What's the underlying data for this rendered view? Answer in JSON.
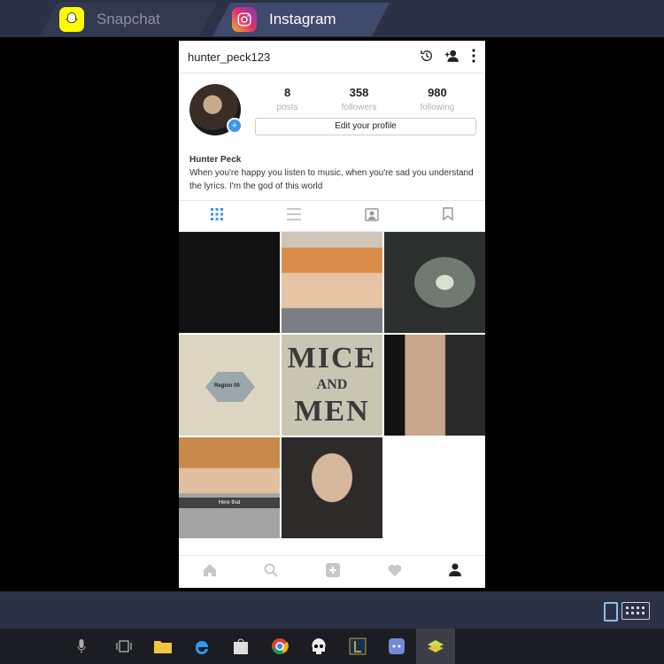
{
  "tabs": [
    {
      "label": "Snapchat",
      "icon": "snapchat-ghost-icon"
    },
    {
      "label": "Instagram",
      "icon": "instagram-icon"
    }
  ],
  "profile": {
    "username": "hunter_peck123",
    "posts_count": "8",
    "posts_label": "posts",
    "followers_count": "358",
    "followers_label": "followers",
    "following_count": "980",
    "following_label": "following",
    "edit_button_label": "Edit your profile",
    "name": "Hunter Peck",
    "bio": "When you're happy you listen to music, when you're sad you understand the lyrics.      I'm the god of this world"
  },
  "grid": {
    "mice_line1": "MICE",
    "mice_line2": "AND",
    "mice_line3": "MEN",
    "hex_label": "Region 00",
    "photo_caption": "Here that"
  },
  "colors": {
    "accent_blue": "#3897f0",
    "window_chrome": "#2b3246",
    "active_tab": "#3f4a6c"
  }
}
